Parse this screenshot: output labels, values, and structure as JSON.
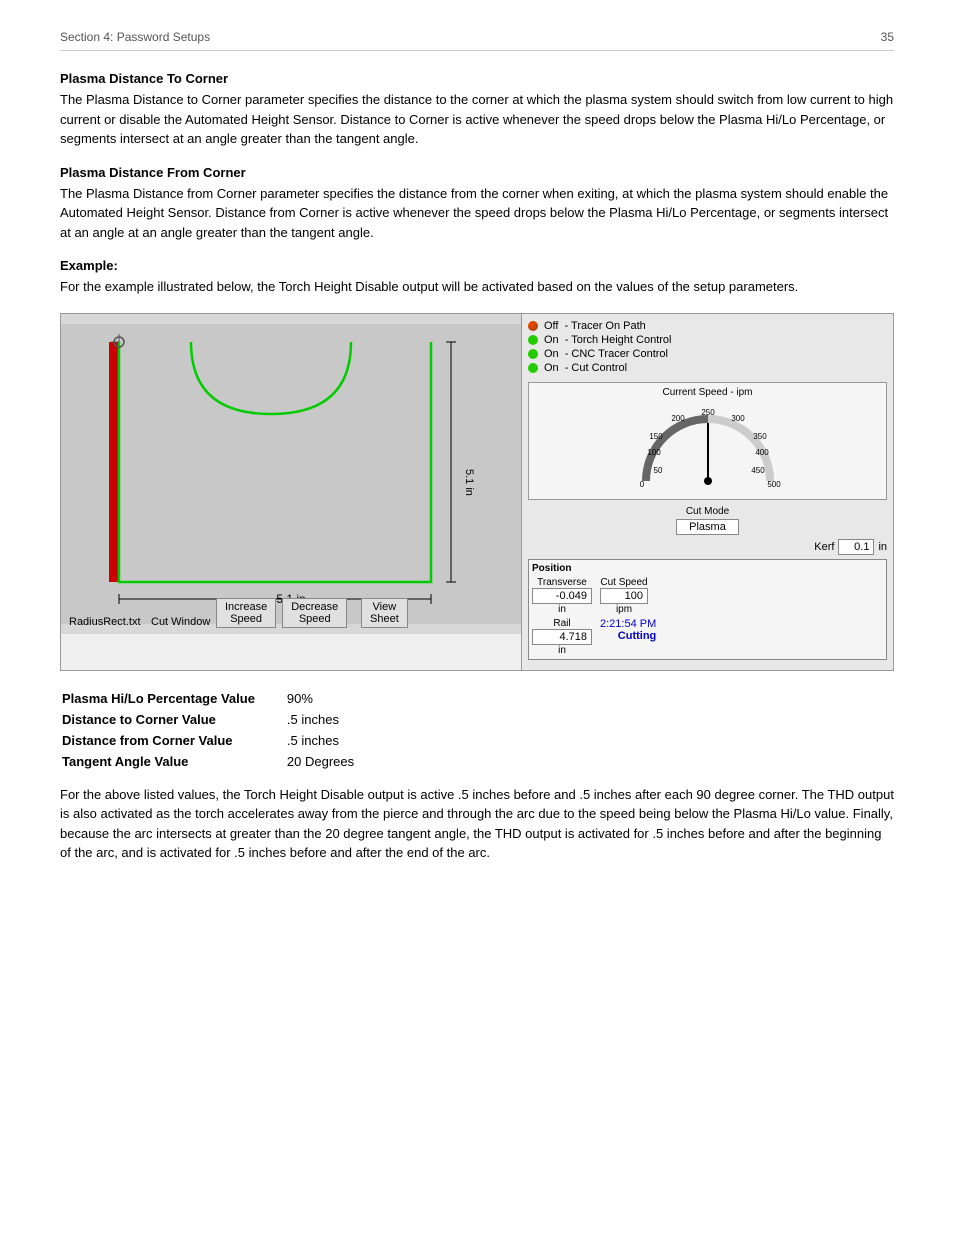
{
  "header": {
    "section_label": "Section 4: Password Setups",
    "page_number": "35"
  },
  "sections": [
    {
      "id": "plasma_distance_to_corner",
      "title": "Plasma Distance To Corner",
      "body": "The Plasma Distance to Corner parameter specifies the distance to the corner at which the plasma system should switch from low current to high current or disable the Automated Height Sensor. Distance to Corner is active whenever the speed drops below the Plasma Hi/Lo Percentage, or segments intersect at an angle greater than the tangent angle."
    },
    {
      "id": "plasma_distance_from_corner",
      "title": "Plasma Distance From Corner",
      "body": "The Plasma Distance from Corner parameter specifies the distance from the corner when exiting, at which the plasma system should enable the Automated Height Sensor.  Distance from Corner is active whenever the speed drops below the Plasma Hi/Lo Percentage, or segments intersect at an angle at an angle greater than the tangent angle."
    },
    {
      "id": "example",
      "title": "Example:",
      "body": "For the example illustrated below, the Torch Height Disable output will be activated based on the values of the setup parameters."
    }
  ],
  "diagram": {
    "width_label": "5.1 in",
    "height_label": "5.1 in",
    "filename": "RadiusRect.txt",
    "cut_window_label": "Cut Window"
  },
  "right_panel": {
    "status_items": [
      {
        "dot": "mixed",
        "state": "Off",
        "label": "Tracer On Path"
      },
      {
        "dot": "green",
        "state": "On",
        "label": "Torch Height Control"
      },
      {
        "dot": "green",
        "state": "On",
        "label": "CNC Tracer Control"
      },
      {
        "dot": "green",
        "state": "On",
        "label": "Cut Control"
      }
    ],
    "speed_label": "Current Speed - ipm",
    "gauge_value": 250,
    "gauge_max": 500,
    "gauge_ticks": [
      "0",
      "50",
      "100",
      "150",
      "200",
      "250",
      "300",
      "350",
      "400",
      "450",
      "500"
    ],
    "cut_mode_label": "Cut Mode",
    "cut_mode_value": "Plasma",
    "kerf_label": "Kerf",
    "kerf_value": "0.1",
    "kerf_unit": "in",
    "position_label": "Position",
    "transverse_label": "Transverse",
    "transverse_value": "-0.049",
    "transverse_unit": "in",
    "rail_label": "Rail",
    "rail_value": "4.718",
    "rail_unit": "in",
    "cut_speed_label": "Cut Speed",
    "cut_speed_value": "100",
    "cut_speed_unit": "ipm",
    "time_value": "2:21:54 PM",
    "status_cutting": "Cutting"
  },
  "buttons": {
    "increase_speed": "Increase\nSpeed",
    "decrease_speed": "Decrease\nSpeed",
    "view_sheet": "View\nSheet"
  },
  "params": [
    {
      "label": "Plasma Hi/Lo Percentage Value",
      "value": "90%"
    },
    {
      "label": "Distance to Corner Value",
      "value": ".5 inches"
    },
    {
      "label": "Distance from Corner Value",
      "value": ".5 inches"
    },
    {
      "label": "Tangent Angle Value",
      "value": "20 Degrees"
    }
  ],
  "conclusion_text": "For the above listed values, the Torch Height Disable output is active .5 inches before and .5 inches after each 90 degree corner.  The THD output is also activated as the torch accelerates away from the pierce and through the arc due to the speed being below the Plasma Hi/Lo value.  Finally, because the arc intersects at greater than the 20 degree tangent angle, the THD output is activated for .5 inches before and after the beginning of the arc, and is activated for .5 inches before and after the end of the arc."
}
